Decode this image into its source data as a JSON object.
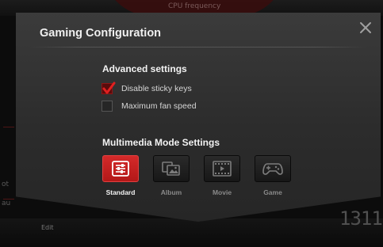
{
  "background": {
    "cpu_label": "CPU frequency",
    "left_text_1": "ot",
    "left_text_2": "au",
    "edit_label": "Edit",
    "number_value": "1311"
  },
  "dialog": {
    "title": "Gaming Configuration",
    "close_icon": "close-icon",
    "advanced": {
      "heading": "Advanced settings",
      "options": [
        {
          "label": "Disable sticky keys",
          "checked": true
        },
        {
          "label": "Maximum fan speed",
          "checked": false
        }
      ]
    },
    "multimedia": {
      "heading": "Multimedia Mode Settings",
      "modes": [
        {
          "label": "Standard",
          "icon": "sliders-icon",
          "active": true
        },
        {
          "label": "Album",
          "icon": "album-icon",
          "active": false
        },
        {
          "label": "Movie",
          "icon": "film-icon",
          "active": false
        },
        {
          "label": "Game",
          "icon": "gamepad-icon",
          "active": false
        }
      ]
    }
  },
  "colors": {
    "accent": "#c81f1f",
    "dialog_bg": "#333333",
    "text": "#f0f0f0"
  }
}
